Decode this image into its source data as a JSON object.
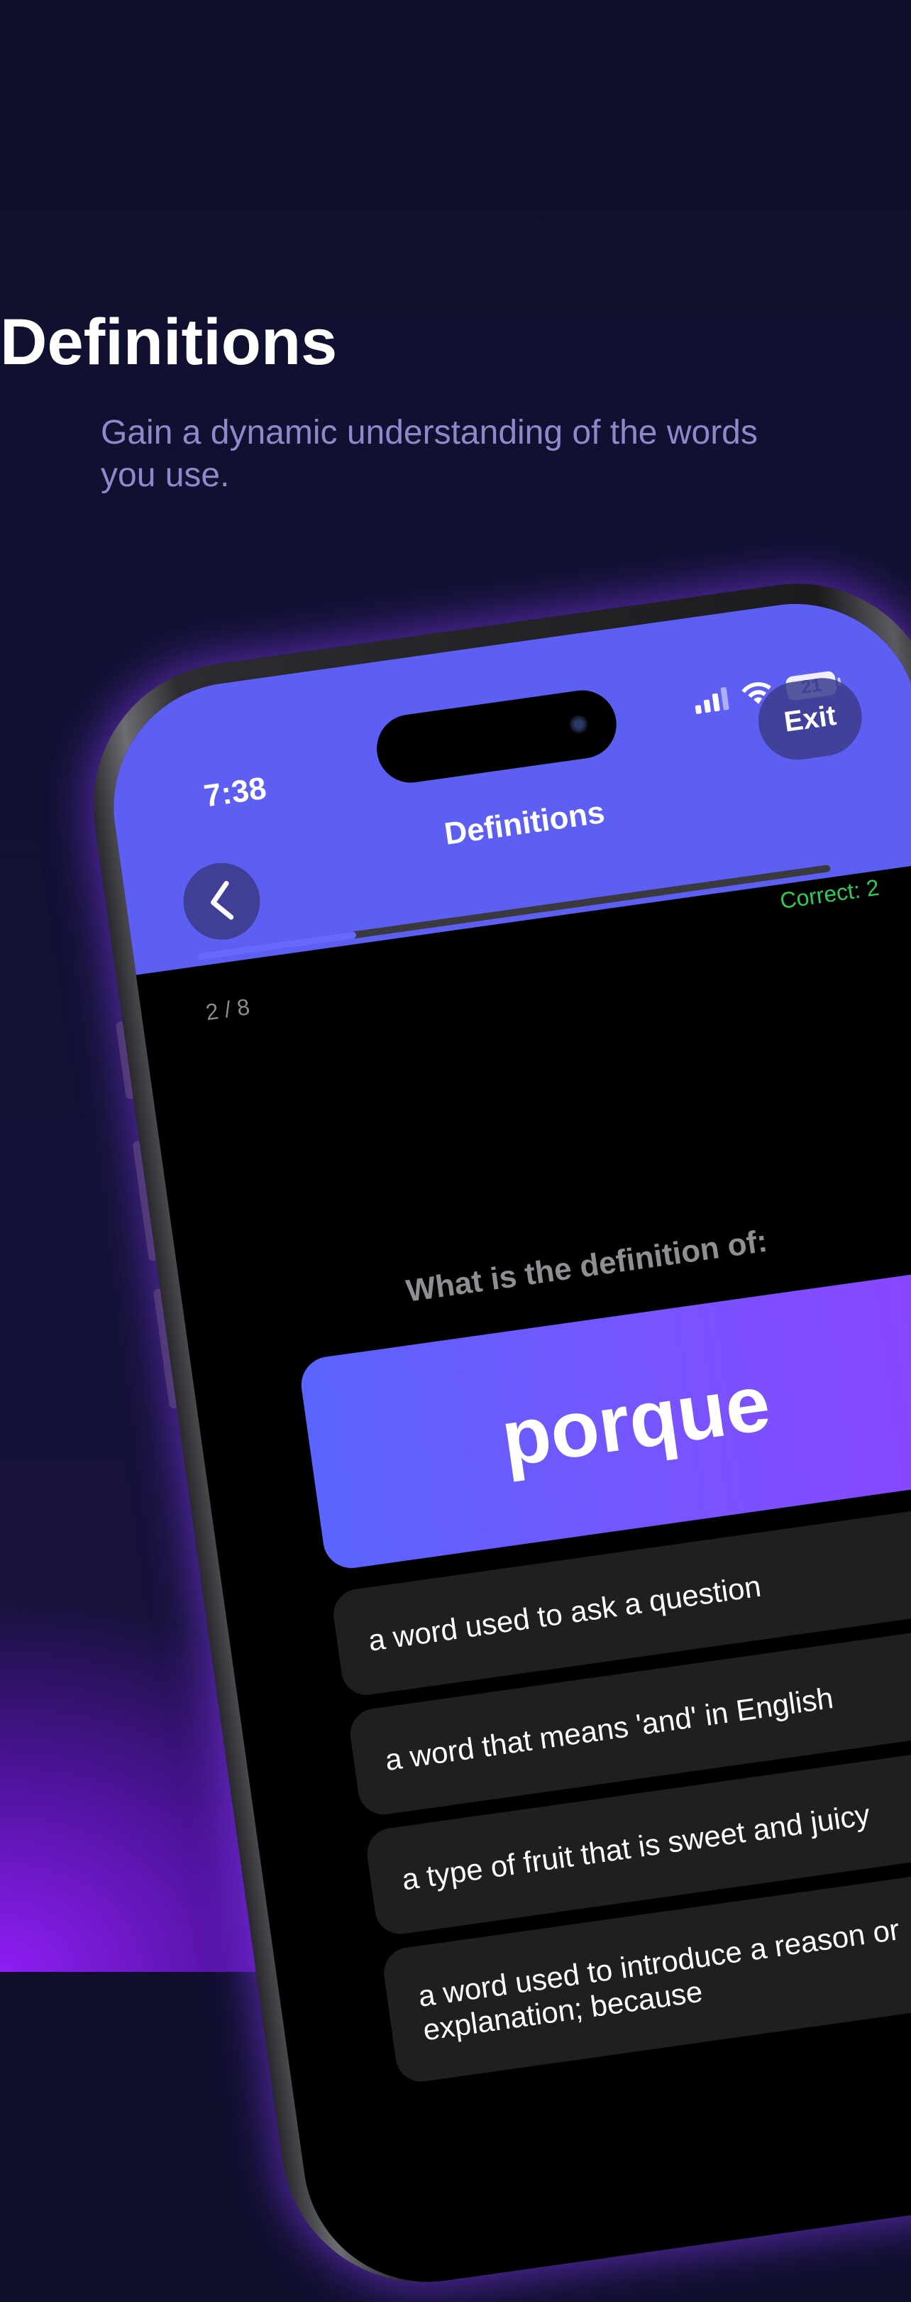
{
  "hero": {
    "title": "Definitions",
    "subtitle": "Gain a dynamic understanding of the words you use."
  },
  "status_bar": {
    "time": "7:38",
    "battery": "21"
  },
  "header": {
    "title": "Definitions",
    "exit_label": "Exit",
    "back_icon": "chevron-left-icon"
  },
  "progress": {
    "current": 2,
    "total": 8,
    "label": "2 / 8",
    "fraction": 0.25,
    "correct_label": "Correct: 2"
  },
  "quiz": {
    "question": "What is the definition of:",
    "word": "porque",
    "options": [
      "a word used to ask a question",
      "a word that means 'and' in English",
      "a type of fruit that is sweet and juicy",
      "a word used to introduce a reason or explanation; because"
    ]
  },
  "colors": {
    "background": "#0f0f2d",
    "accent": "#5d5ef2",
    "correct": "#2ecc55",
    "glow": "#961eff"
  }
}
